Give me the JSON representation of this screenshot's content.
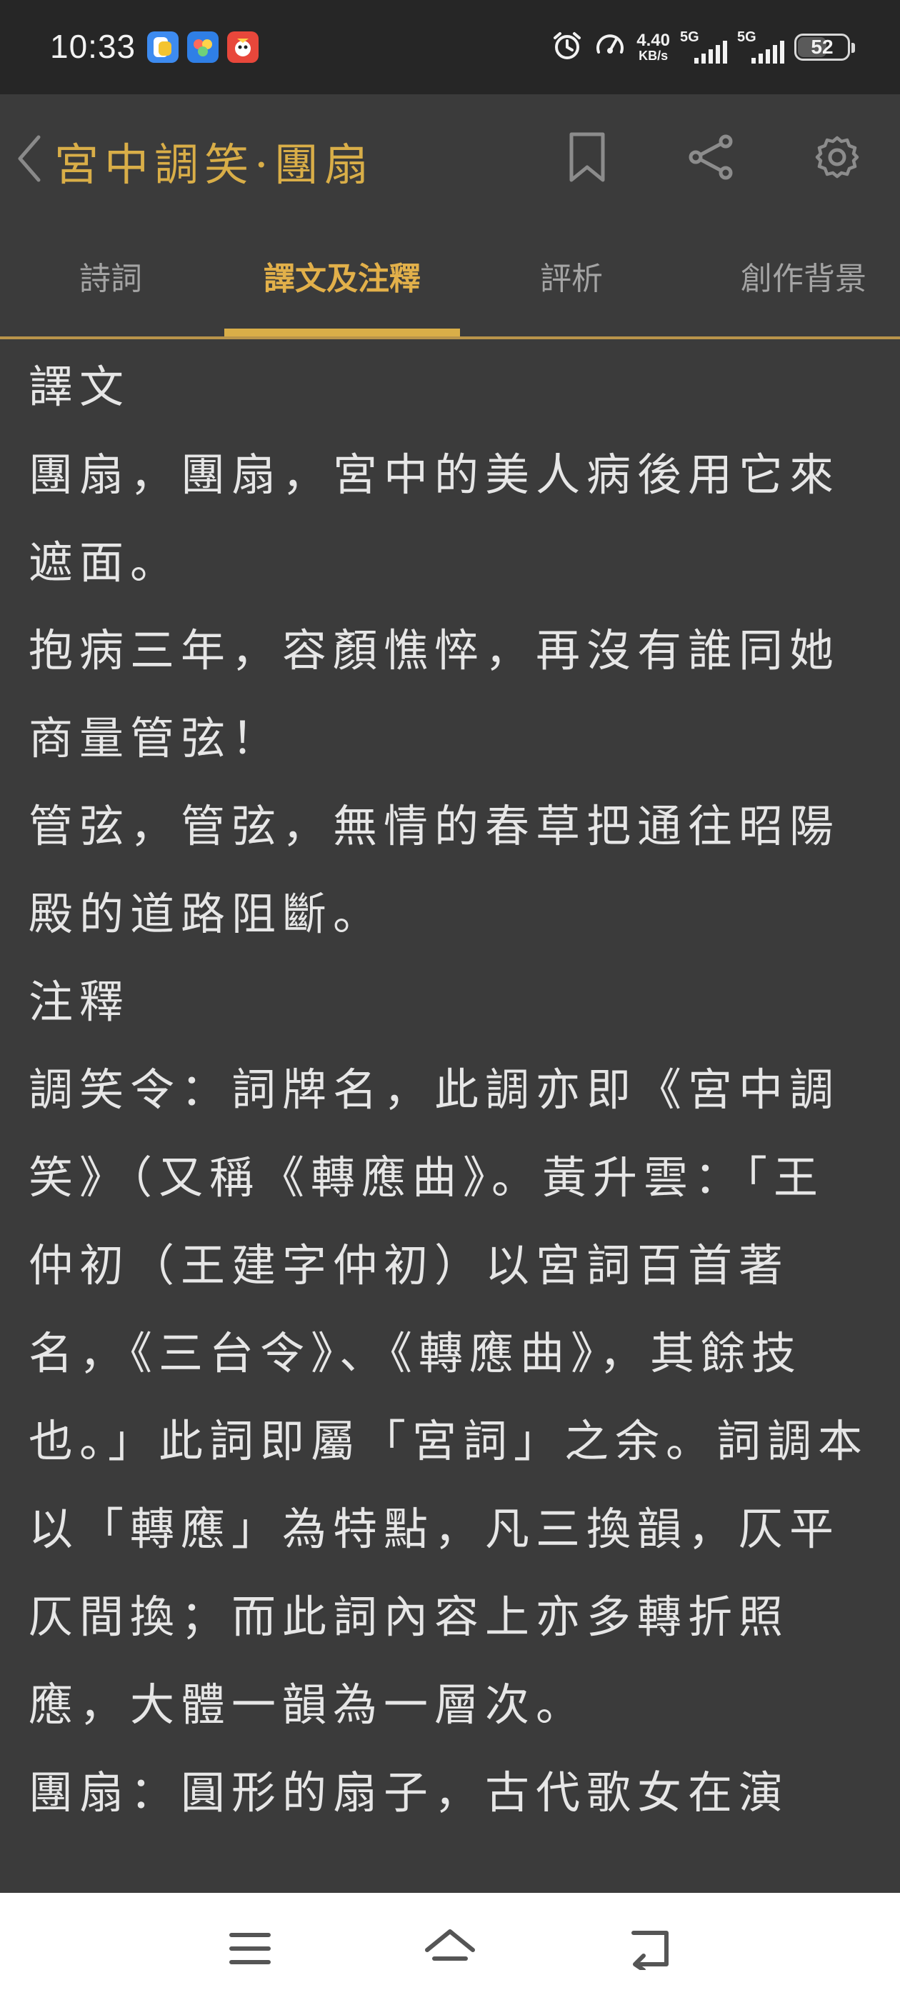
{
  "status_bar": {
    "time": "10:33",
    "net_speed": "4.40",
    "net_speed_unit": "KB/s",
    "signal1_label": "5G",
    "signal2_label": "5G",
    "battery": "52",
    "app_icons": [
      "app-icon-blue",
      "app-icon-colorful",
      "app-icon-red"
    ]
  },
  "header": {
    "title": "宮中調笑·團扇",
    "icons": [
      "back-chevron-icon",
      "bookmark-icon",
      "share-icon",
      "gear-icon"
    ]
  },
  "tabs": [
    {
      "label": "詩詞",
      "active": false
    },
    {
      "label": "譯文及注釋",
      "active": true
    },
    {
      "label": "評析",
      "active": false
    },
    {
      "label": "創作背景",
      "active": false
    }
  ],
  "content": {
    "paragraphs": [
      "譯文",
      "團扇，團扇，宮中的美人病後用它來遮面。",
      "抱病三年，容顏憔悴，再沒有誰同她商量管弦！",
      "管弦，管弦，無情的春草把通往昭陽殿的道路阻斷。",
      "注釋",
      "調笑令：詞牌名，此調亦即《宮中調笑》（又稱《轉應曲》。黃升雲：「王仲初（王建字仲初）以宮詞百首著名，《三台令》、《轉應曲》，其餘技也。」此詞即屬「宮詞」之余。詞調本以「轉應」為特點，凡三換韻，仄平仄間換；而此詞內容上亦多轉折照應，大體一韻為一層次。",
      "團扇：圓形的扇子，古代歌女在演"
    ]
  },
  "nav_bar": {
    "icons": [
      "menu-icon",
      "home-icon",
      "back-icon"
    ]
  },
  "colors": {
    "accent": "#d9ae48",
    "background": "#3b3b3b",
    "status_bar": "#262626",
    "text": "#e6e6e6",
    "tab_inactive": "#a4a4a4"
  }
}
